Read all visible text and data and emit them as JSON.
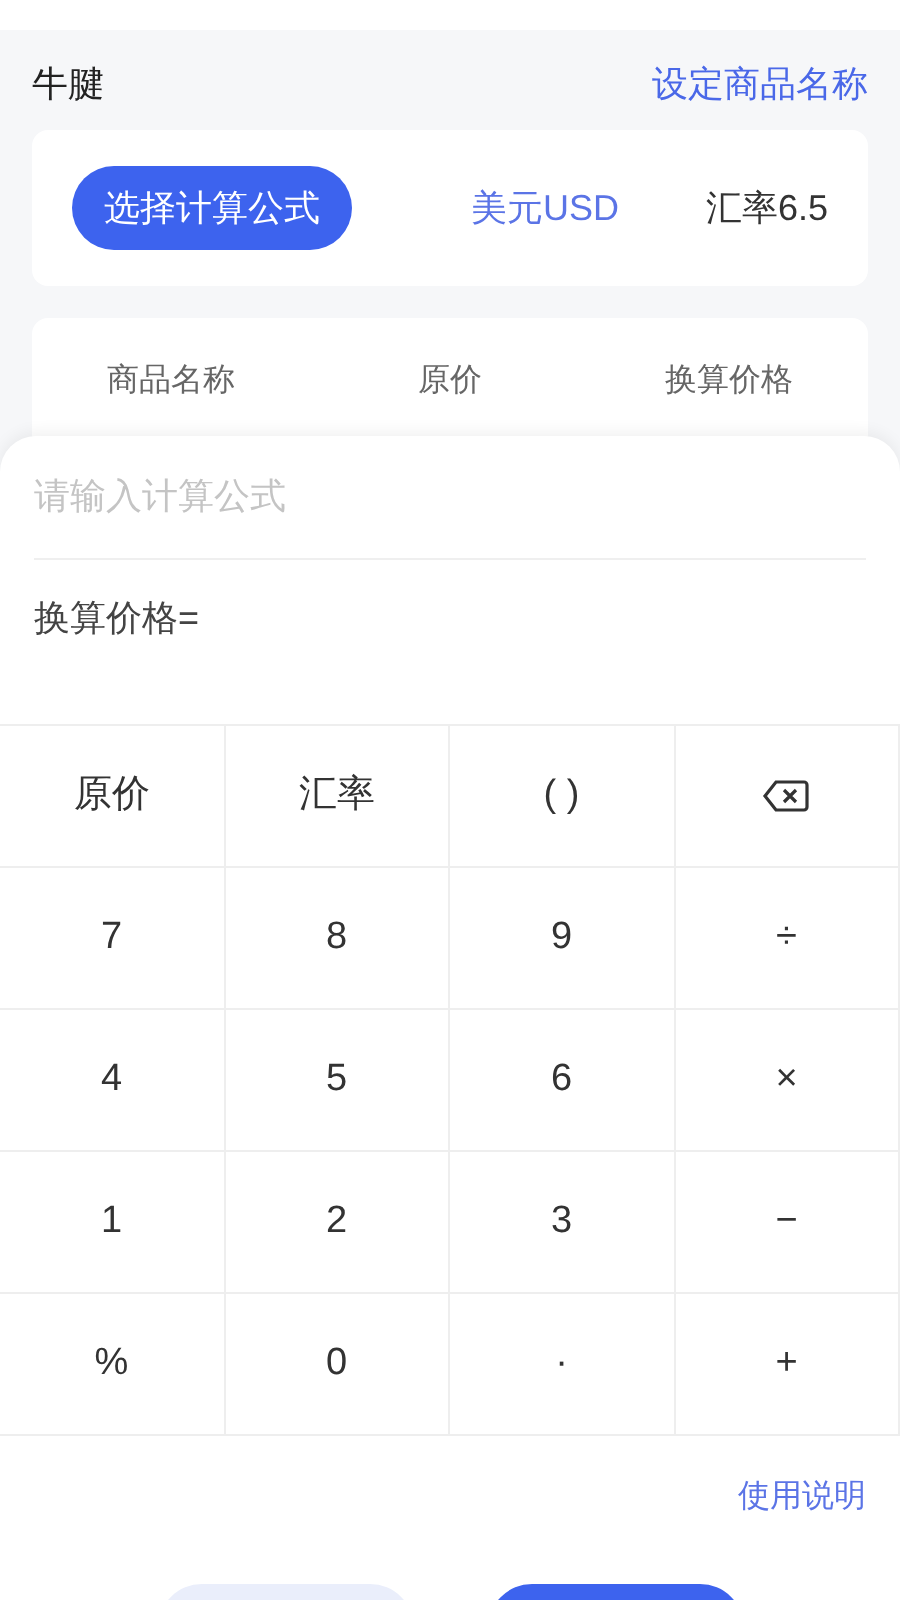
{
  "header": {
    "product": "牛腱",
    "action": "设定商品名称"
  },
  "options": {
    "formula_button": "选择计算公式",
    "currency": "美元USD",
    "rate": "汇率6.5"
  },
  "table": {
    "columns": [
      "商品名称",
      "原价",
      "换算价格"
    ]
  },
  "formula": {
    "placeholder": "请输入计算公式",
    "result_label": "换算价格="
  },
  "keypad": [
    [
      {
        "kind": "text",
        "label": "原价"
      },
      {
        "kind": "text",
        "label": "汇率"
      },
      {
        "kind": "text",
        "label": "( )"
      },
      {
        "kind": "delete"
      }
    ],
    [
      {
        "kind": "text",
        "label": "7"
      },
      {
        "kind": "text",
        "label": "8"
      },
      {
        "kind": "text",
        "label": "9"
      },
      {
        "kind": "text",
        "label": "÷"
      }
    ],
    [
      {
        "kind": "text",
        "label": "4"
      },
      {
        "kind": "text",
        "label": "5"
      },
      {
        "kind": "text",
        "label": "6"
      },
      {
        "kind": "text",
        "label": "×"
      }
    ],
    [
      {
        "kind": "text",
        "label": "1"
      },
      {
        "kind": "text",
        "label": "2"
      },
      {
        "kind": "text",
        "label": "3"
      },
      {
        "kind": "text",
        "label": "−"
      }
    ],
    [
      {
        "kind": "text",
        "label": "%"
      },
      {
        "kind": "text",
        "label": "0"
      },
      {
        "kind": "text",
        "label": "·"
      },
      {
        "kind": "text",
        "label": "+"
      }
    ]
  ],
  "help_link": "使用说明",
  "bottom_buttons": [
    {
      "kind": "secondary"
    },
    {
      "kind": "primary"
    }
  ]
}
